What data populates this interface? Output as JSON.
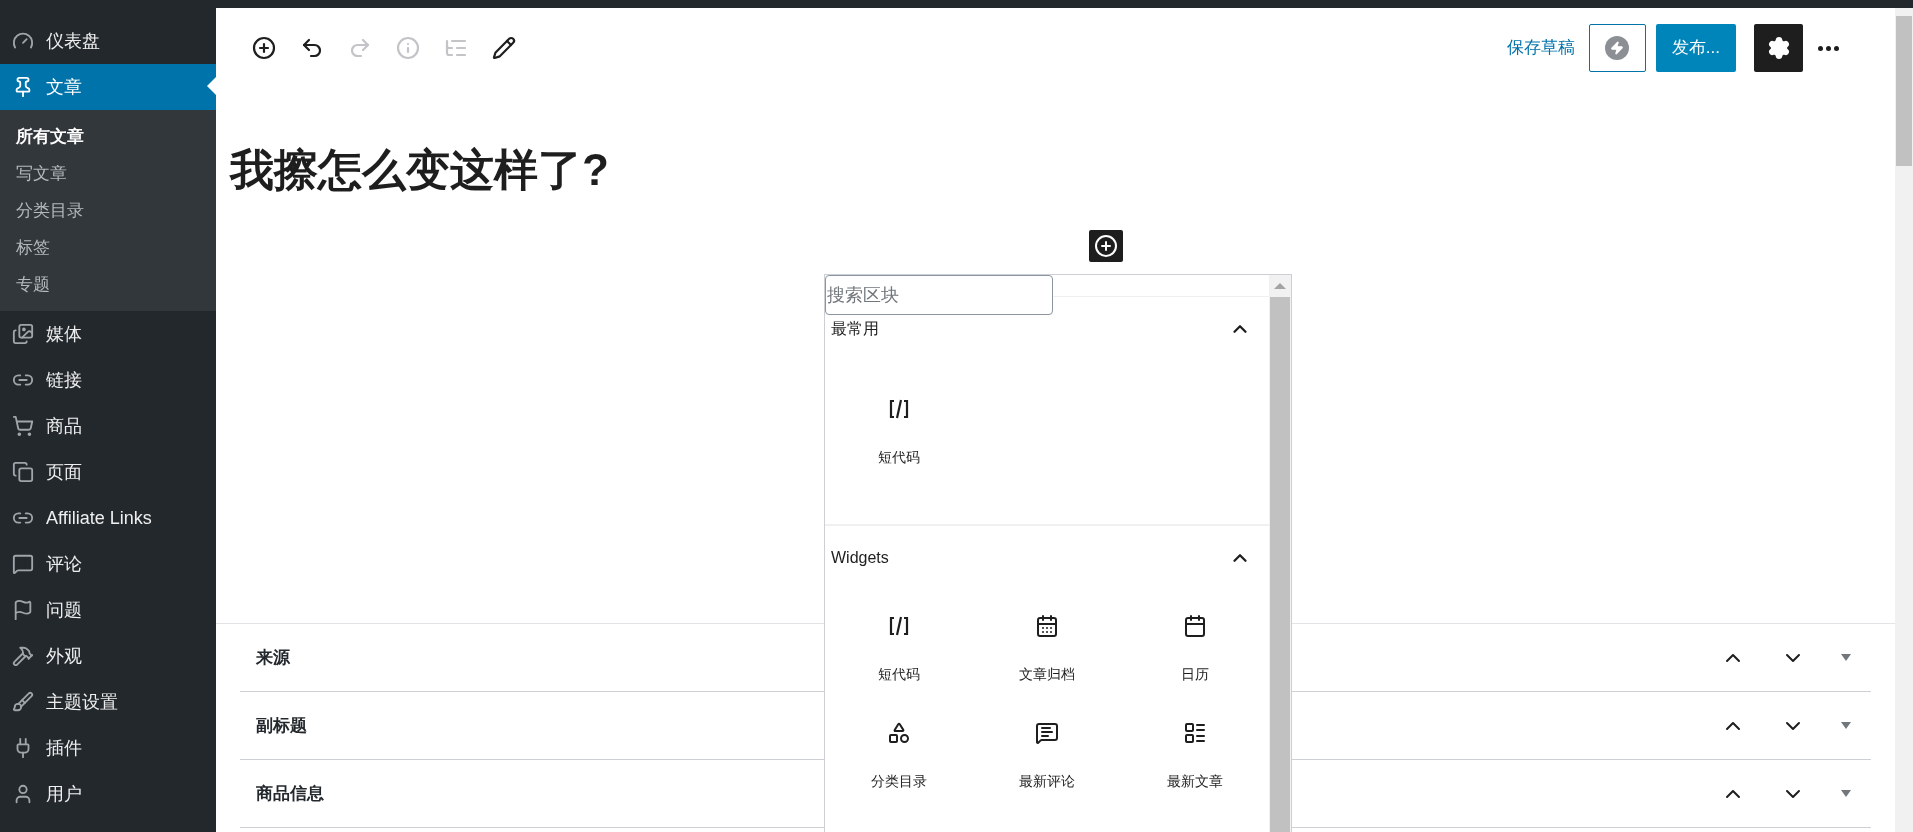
{
  "sidebar": {
    "items": [
      {
        "kind": "dashboard",
        "label": "仪表盘",
        "selected": false
      },
      {
        "kind": "posts",
        "label": "文章",
        "selected": true,
        "children": [
          {
            "label": "所有文章",
            "selected": true
          },
          {
            "label": "写文章",
            "selected": false
          },
          {
            "label": "分类目录",
            "selected": false
          },
          {
            "label": "标签",
            "selected": false
          },
          {
            "label": "专题",
            "selected": false
          }
        ]
      },
      {
        "kind": "media",
        "label": "媒体",
        "selected": false
      },
      {
        "kind": "links",
        "label": "链接",
        "selected": false
      },
      {
        "kind": "products",
        "label": "商品",
        "selected": false
      },
      {
        "kind": "pages",
        "label": "页面",
        "selected": false
      },
      {
        "kind": "links",
        "label": "Affiliate Links",
        "selected": false
      },
      {
        "kind": "comments",
        "label": "评论",
        "selected": false
      },
      {
        "kind": "questions",
        "label": "问题",
        "selected": false
      },
      {
        "kind": "appearance",
        "label": "外观",
        "selected": false
      },
      {
        "kind": "theme",
        "label": "主题设置",
        "selected": false
      },
      {
        "kind": "plugins",
        "label": "插件",
        "selected": false
      },
      {
        "kind": "users",
        "label": "用户",
        "selected": false
      }
    ]
  },
  "toolbar": {
    "tools": [
      {
        "kind": "add",
        "disabled": false
      },
      {
        "kind": "undo",
        "disabled": false
      },
      {
        "kind": "redo",
        "disabled": true
      },
      {
        "kind": "info",
        "disabled": true
      },
      {
        "kind": "outline",
        "disabled": true
      },
      {
        "kind": "edit",
        "disabled": false
      }
    ],
    "save_draft": "保存草稿",
    "publish": "发布..."
  },
  "post_title": "我擦怎么变这样了?",
  "inserter": {
    "search": {
      "placeholder": "搜索区块"
    },
    "sections": [
      {
        "title": "最常用",
        "expanded": true,
        "blocks": [
          {
            "kind": "shortcode",
            "label": "短代码"
          }
        ]
      },
      {
        "title": "Widgets",
        "expanded": true,
        "blocks": [
          {
            "kind": "shortcode",
            "label": "短代码"
          },
          {
            "kind": "archives",
            "label": "文章归档"
          },
          {
            "kind": "calendar",
            "label": "日历"
          },
          {
            "kind": "categories",
            "label": "分类目录"
          },
          {
            "kind": "comments",
            "label": "最新评论"
          },
          {
            "kind": "posts",
            "label": "最新文章"
          }
        ]
      }
    ]
  },
  "meta_boxes": [
    {
      "title": "来源"
    },
    {
      "title": "副标题"
    },
    {
      "title": "商品信息"
    }
  ]
}
